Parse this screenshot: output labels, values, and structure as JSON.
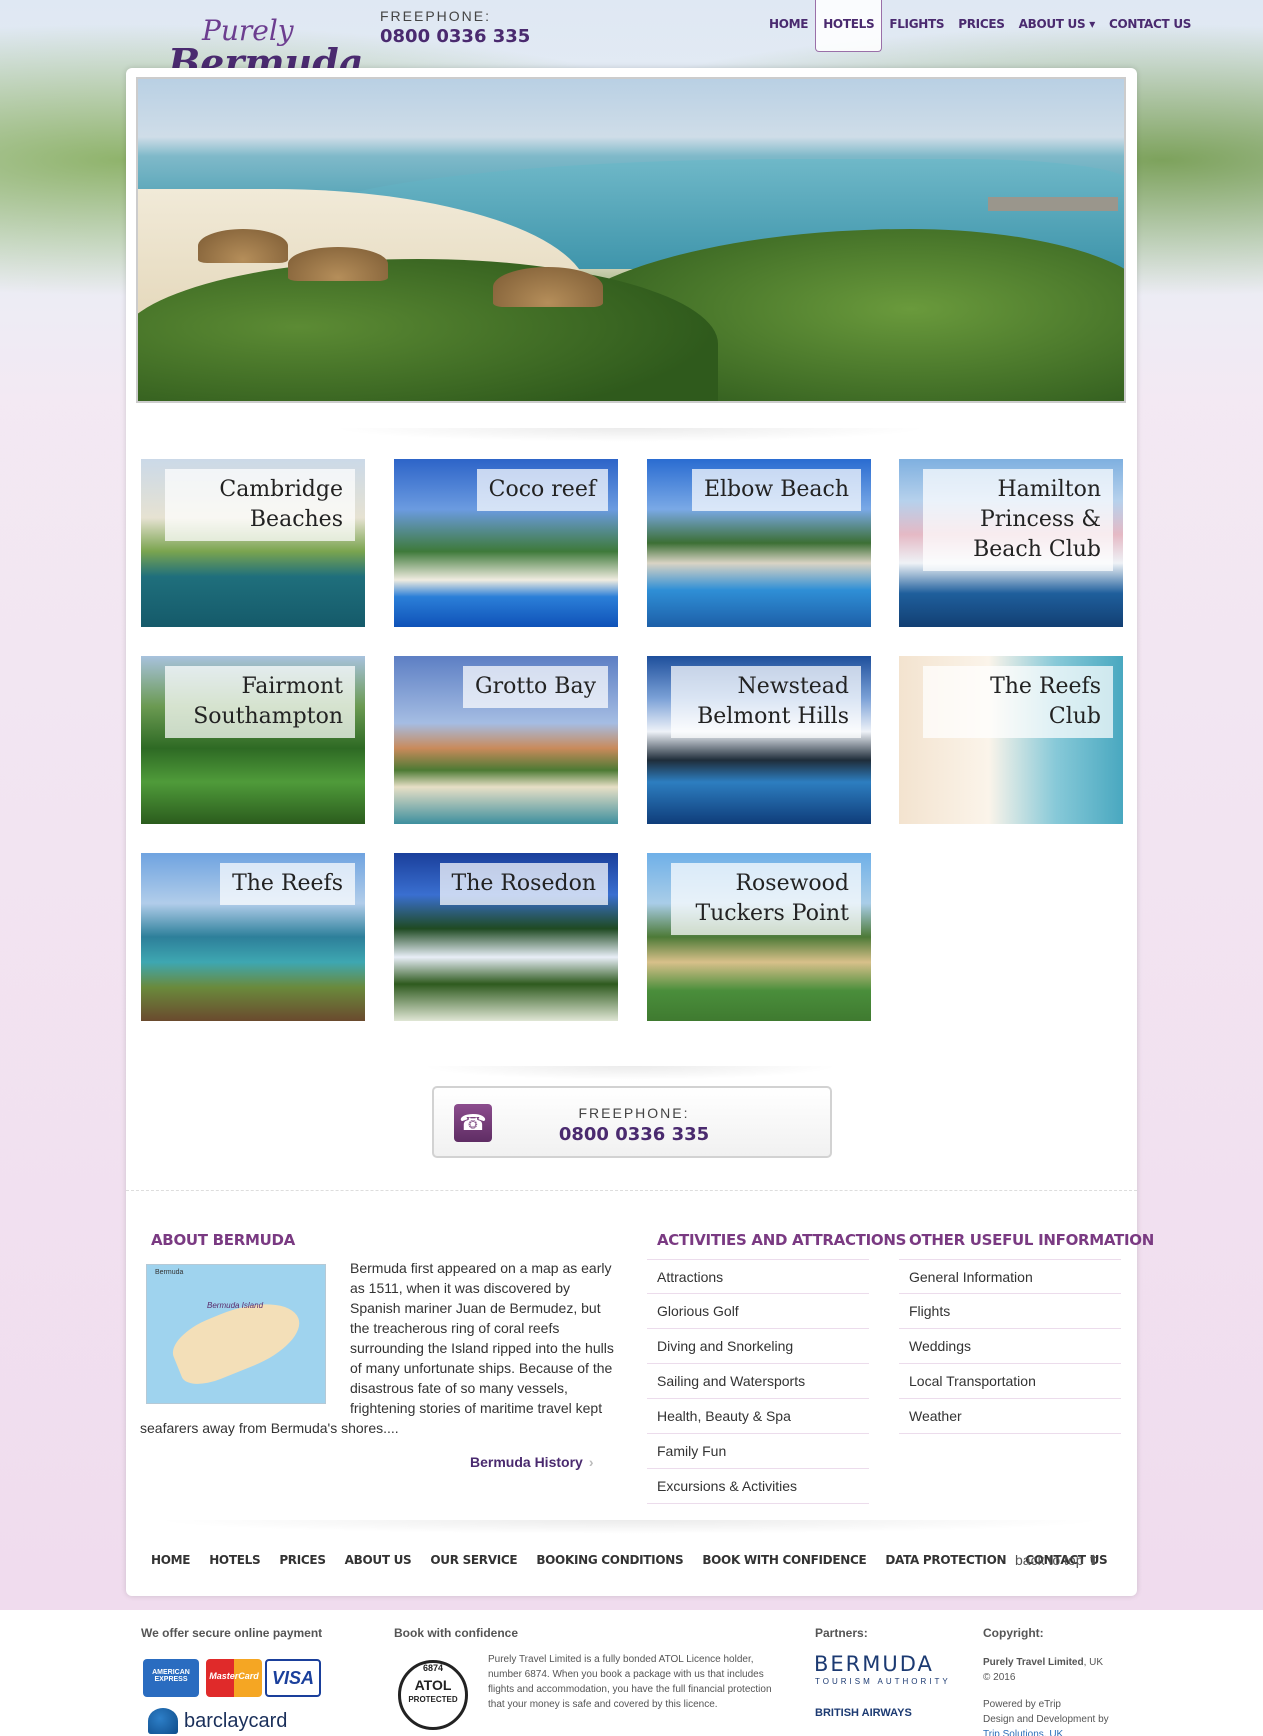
{
  "header": {
    "logo_line1": "Purely",
    "logo_line2": "Bermuda",
    "freephone_label": "FREEPHONE:",
    "freephone_number": "0800 0336 335"
  },
  "nav": {
    "items": [
      {
        "label": "HOME"
      },
      {
        "label": "HOTELS",
        "active": true
      },
      {
        "label": "FLIGHTS"
      },
      {
        "label": "PRICES"
      },
      {
        "label": "ABOUT US ▾"
      },
      {
        "label": "CONTACT US"
      }
    ]
  },
  "hotels": [
    {
      "name": "Cambridge Beaches"
    },
    {
      "name": "Coco reef"
    },
    {
      "name": "Elbow Beach"
    },
    {
      "name": "Hamilton Princess & Beach Club"
    },
    {
      "name": "Fairmont Southampton"
    },
    {
      "name": "Grotto Bay"
    },
    {
      "name": "Newstead Belmont Hills"
    },
    {
      "name": "The Reefs Club"
    },
    {
      "name": "The Reefs"
    },
    {
      "name": "The Rosedon"
    },
    {
      "name": "Rosewood Tuckers Point"
    }
  ],
  "phone_box": {
    "label": "FREEPHONE:",
    "number": "0800 0336 335"
  },
  "about": {
    "title": "ABOUT BERMUDA",
    "map_title": "Bermuda",
    "map_island_label": "Bermuda Island",
    "text": "Bermuda first appeared on a map as early as 1511, when it was discovered by Spanish mariner Juan de Bermudez, but the treacherous ring of coral reefs surrounding the Island ripped into the hulls of many unfortunate ships. Because of the disastrous fate of so many vessels, frightening stories of maritime travel kept seafarers away from Bermuda's shores....",
    "link": "Bermuda History"
  },
  "activities": {
    "title": "ACTIVITIES AND ATTRACTIONS",
    "items": [
      "Attractions",
      "Glorious Golf",
      "Diving and Snorkeling",
      "Sailing and Watersports",
      "Health, Beauty & Spa",
      "Family Fun",
      "Excursions & Activities"
    ]
  },
  "useful": {
    "title": "OTHER USEFUL INFORMATION",
    "items": [
      "General Information",
      "Flights",
      "Weddings",
      "Local Transportation",
      "Weather"
    ]
  },
  "bottom_nav": {
    "items": [
      "HOME",
      "HOTELS",
      "PRICES",
      "ABOUT US",
      "OUR SERVICE",
      "BOOKING CONDITIONS",
      "BOOK WITH CONFIDENCE",
      "DATA PROTECTION",
      "CONTACT US"
    ],
    "back_to_top": "back to top ⬆"
  },
  "footer": {
    "payment_title": "We offer secure online payment",
    "cards": [
      "AMERICAN EXPRESS",
      "MasterCard",
      "VISA"
    ],
    "barclaycard": "barclaycard",
    "confidence_title": "Book with confidence",
    "atol_number": "6874",
    "atol_word": "ATOL",
    "atol_protected": "PROTECTED",
    "atol_text": "Purely Travel Limited is a fully bonded ATOL Licence holder, number 6874. When you book a package with us that includes flights and accommodation, you have the full financial protection that your money is safe and covered by this licence.",
    "partners_title": "Partners:",
    "partner_bermuda": "BERMUDA",
    "partner_bermuda_sub": "TOURISM AUTHORITY",
    "partner_ba": "BRITISH AIRWAYS",
    "copyright_title": "Copyright:",
    "copyright_company": "Purely Travel Limited",
    "copyright_country": ", UK",
    "copyright_year": "© 2016",
    "powered_by": "Powered by eTrip",
    "design_by": "Design and Development by",
    "design_company": "Trip Solutions, UK"
  },
  "colors": {
    "brand_purple": "#4a2a6f",
    "section_title": "#7a3a82"
  }
}
